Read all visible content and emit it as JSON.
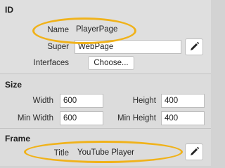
{
  "sections": {
    "id": {
      "title": "ID",
      "name_label": "Name",
      "name_value": "PlayerPage",
      "super_label": "Super",
      "super_value": "WebPage",
      "interfaces_label": "Interfaces",
      "interfaces_button": "Choose..."
    },
    "size": {
      "title": "Size",
      "width_label": "Width",
      "width_value": "600",
      "height_label": "Height",
      "height_value": "400",
      "min_width_label": "Min Width",
      "min_width_value": "600",
      "min_height_label": "Min Height",
      "min_height_value": "400"
    },
    "frame": {
      "title": "Frame",
      "title_label": "Title",
      "title_value": "YouTube Player"
    }
  },
  "icons": {
    "edit": "pencil-icon"
  },
  "colors": {
    "highlight": "#f0b21a",
    "panel_bg": "#dfdfdf",
    "field_bg": "#ffffff"
  }
}
